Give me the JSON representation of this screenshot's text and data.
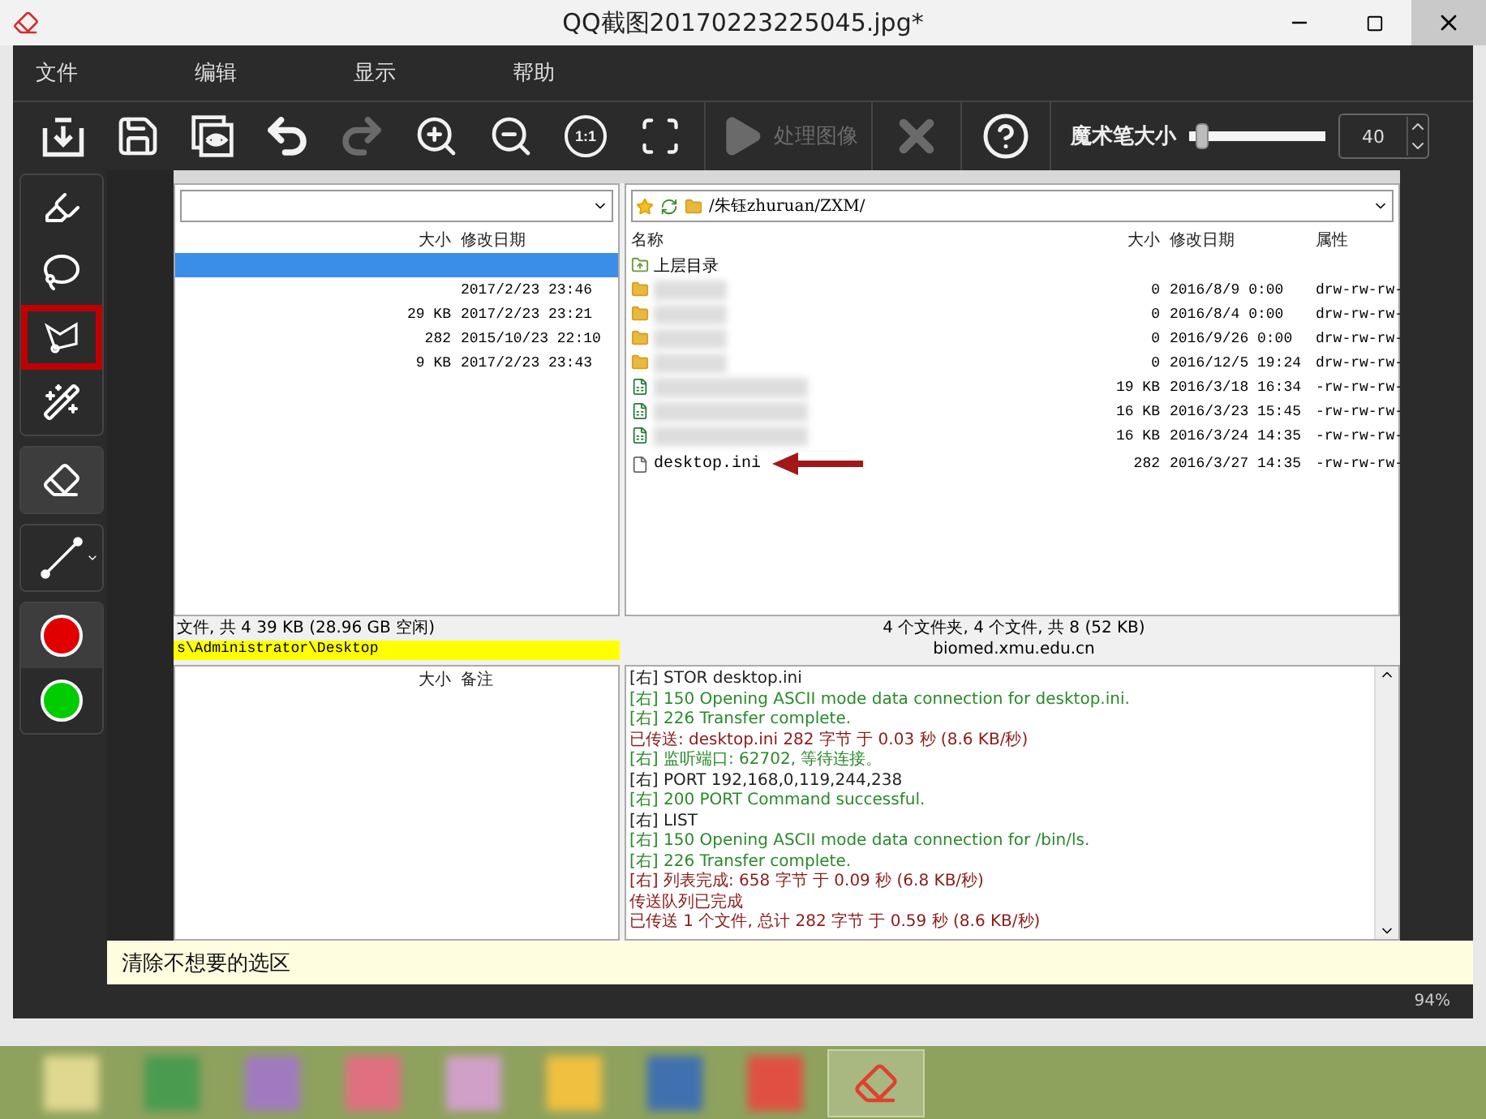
{
  "window": {
    "title": "QQ截图20170223225045.jpg*"
  },
  "menu": [
    "文件",
    "编辑",
    "显示",
    "帮助"
  ],
  "toolbar": [
    {
      "kind": "open",
      "disabled": false
    },
    {
      "kind": "save",
      "disabled": false
    },
    {
      "kind": "preview",
      "disabled": false
    },
    {
      "kind": "undo",
      "disabled": false
    },
    {
      "kind": "redo",
      "disabled": true
    },
    {
      "kind": "zoom-in",
      "disabled": false
    },
    {
      "kind": "zoom-out",
      "disabled": false
    },
    {
      "kind": "actual-size",
      "label": "1:1",
      "disabled": false
    },
    {
      "kind": "fit",
      "disabled": false
    },
    {
      "kind": "process",
      "label": "处理图像",
      "disabled": true
    },
    {
      "kind": "cancel",
      "disabled": true
    },
    {
      "kind": "help",
      "disabled": false
    }
  ],
  "brush_size": {
    "label": "魔术笔大小",
    "level": 0.05,
    "value": "40"
  },
  "tools": [
    [
      {
        "kind": "brush",
        "selected": false,
        "annotated": false
      },
      {
        "kind": "lasso",
        "selected": false,
        "annotated": false
      },
      {
        "kind": "polygon-lasso",
        "selected": false,
        "annotated": true
      },
      {
        "kind": "magic-wand",
        "selected": false,
        "annotated": false
      }
    ],
    [
      {
        "kind": "eraser",
        "selected": true,
        "annotated": false
      }
    ],
    [
      {
        "kind": "line",
        "selected": false,
        "annotated": false
      }
    ]
  ],
  "colors": [
    {
      "color": "#e00000",
      "selected": true
    },
    {
      "color": "#00cc00",
      "selected": false
    }
  ],
  "canvas": {
    "local": {
      "columns": [
        "大小",
        "修改日期"
      ],
      "rows": [
        {
          "selected": true
        },
        {
          "date": "2017/2/23 23:46",
          "selected": false
        },
        {
          "size": "29 KB",
          "date": "2017/2/23 23:21",
          "selected": false
        },
        {
          "size": "282",
          "date": "2015/10/23 22:10",
          "selected": false
        },
        {
          "size": "9 KB",
          "date": "2017/2/23 23:43",
          "selected": false
        }
      ],
      "status": "文件, 共 4 39 KB (28.96 GB 空闲)",
      "path": "s\\Administrator\\Desktop"
    },
    "remote": {
      "path": "/朱钰zhuruan/ZXM/",
      "columns": [
        "名称",
        "大小",
        "修改日期",
        "属性"
      ],
      "rows": [
        {
          "kind": "parent",
          "name": "上层目录",
          "pointed": false
        },
        {
          "kind": "folder",
          "size": "0",
          "date": "2016/8/9 0:00",
          "attr": "drw-rw-rw-",
          "pointed": false
        },
        {
          "kind": "folder",
          "size": "0",
          "date": "2016/8/4 0:00",
          "attr": "drw-rw-rw-",
          "pointed": false
        },
        {
          "kind": "folder",
          "size": "0",
          "date": "2016/9/26 0:00",
          "attr": "drw-rw-rw-",
          "pointed": false
        },
        {
          "kind": "folder",
          "size": "0",
          "date": "2016/12/5 19:24",
          "attr": "drw-rw-rw-",
          "pointed": false
        },
        {
          "kind": "excel",
          "size": "19 KB",
          "date": "2016/3/18 16:34",
          "attr": "-rw-rw-rw-",
          "pointed": false
        },
        {
          "kind": "excel",
          "size": "16 KB",
          "date": "2016/3/23 15:45",
          "attr": "-rw-rw-rw-",
          "pointed": false
        },
        {
          "kind": "excel",
          "size": "16 KB",
          "date": "2016/3/24 14:35",
          "attr": "-rw-rw-rw-",
          "pointed": false
        },
        {
          "kind": "file",
          "name": "desktop.ini",
          "size": "282",
          "date": "2016/3/27 14:35",
          "attr": "-rw-rw-rw-",
          "pointed": true
        }
      ],
      "status": "4 个文件夹, 4 个文件, 共 8 (52 KB)",
      "host": "biomed.xmu.edu.cn"
    },
    "queue": {
      "columns": [
        "大小",
        "备注"
      ]
    },
    "log": [
      {
        "kind": "command",
        "text": "[右] STOR desktop.ini"
      },
      {
        "kind": "reply",
        "text": "[右] 150 Opening ASCII mode data connection for desktop.ini."
      },
      {
        "kind": "reply",
        "text": "[右] 226 Transfer complete."
      },
      {
        "kind": "transfer",
        "text": "已传送: desktop.ini 282 字节 于 0.03 秒 (8.6 KB/秒)"
      },
      {
        "kind": "reply",
        "text": "[右] 监听端口: 62702, 等待连接。"
      },
      {
        "kind": "command",
        "text": "[右] PORT 192,168,0,119,244,238"
      },
      {
        "kind": "reply",
        "text": "[右] 200 PORT Command successful."
      },
      {
        "kind": "command",
        "text": "[右] LIST"
      },
      {
        "kind": "reply",
        "text": "[右] 150 Opening ASCII mode data connection for /bin/ls."
      },
      {
        "kind": "reply",
        "text": "[右] 226 Transfer complete."
      },
      {
        "kind": "transfer",
        "text": "[右] 列表完成: 658 字节 于 0.09 秒 (6.8 KB/秒)"
      },
      {
        "kind": "transfer",
        "text": "传送队列已完成"
      },
      {
        "kind": "transfer",
        "text": "已传送 1 个文件, 总计 282 字节 于 0.59 秒 (8.6 KB/秒)"
      }
    ]
  },
  "hint": "清除不想要的选区",
  "zoom": "94%",
  "taskbar": [
    {
      "kind": "blurred",
      "color": "#e0d890",
      "selected": false
    },
    {
      "kind": "blurred",
      "color": "#4a9a50",
      "selected": false
    },
    {
      "kind": "blurred",
      "color": "#a07ac0",
      "selected": false
    },
    {
      "kind": "blurred",
      "color": "#e07080",
      "selected": false
    },
    {
      "kind": "blurred",
      "color": "#d0a0c8",
      "selected": false
    },
    {
      "kind": "blurred",
      "color": "#f0c040",
      "selected": false
    },
    {
      "kind": "blurred",
      "color": "#4070b0",
      "selected": false
    },
    {
      "kind": "blurred",
      "color": "#e05040",
      "selected": false
    },
    {
      "kind": "app",
      "selected": true
    }
  ]
}
